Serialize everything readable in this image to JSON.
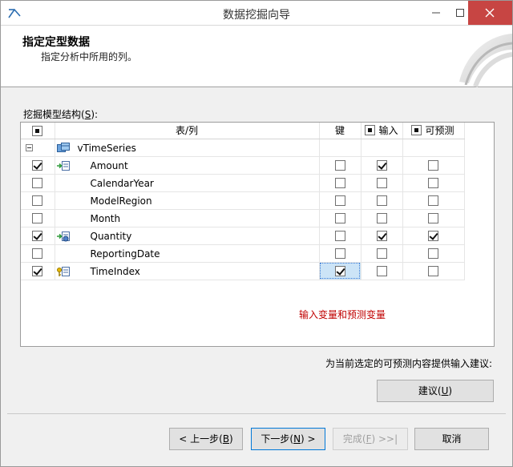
{
  "window": {
    "title": "数据挖掘向导"
  },
  "header": {
    "title": "指定定型数据",
    "subtitle": "指定分析中所用的列。"
  },
  "grid": {
    "label_prefix": "挖掘模型结构(",
    "label_key": "S",
    "label_suffix": "):",
    "columns": {
      "table_column": "表/列",
      "key": "键",
      "input": "输入",
      "predict": "可预测"
    },
    "header_checks": {
      "select": "indeterminate",
      "input": "indeterminate",
      "predict": "indeterminate"
    },
    "table_name": "vTimeSeries",
    "rows": [
      {
        "name": "Amount",
        "select": true,
        "icon": "input-column-icon",
        "key": false,
        "input": true,
        "predict": false
      },
      {
        "name": "CalendarYear",
        "select": false,
        "icon": "",
        "key": false,
        "input": false,
        "predict": false
      },
      {
        "name": "ModelRegion",
        "select": false,
        "icon": "",
        "key": false,
        "input": false,
        "predict": false
      },
      {
        "name": "Month",
        "select": false,
        "icon": "",
        "key": false,
        "input": false,
        "predict": false
      },
      {
        "name": "Quantity",
        "select": true,
        "icon": "predict-column-icon",
        "key": false,
        "input": true,
        "predict": true
      },
      {
        "name": "ReportingDate",
        "select": false,
        "icon": "",
        "key": false,
        "input": false,
        "predict": false
      },
      {
        "name": "TimeIndex",
        "select": true,
        "icon": "key-column-icon",
        "key": true,
        "input": false,
        "predict": false
      }
    ]
  },
  "annotation": "输入变量和预测变量",
  "suggest": {
    "hint": "为当前选定的可预测内容提供输入建议:",
    "button_prefix": "建议(",
    "button_key": "U",
    "button_suffix": ")"
  },
  "footer": {
    "back": {
      "prefix": "< 上一步(",
      "key": "B",
      "suffix": ")"
    },
    "next": {
      "prefix": "下一步(",
      "key": "N",
      "suffix": ") >"
    },
    "finish": {
      "prefix": "完成(",
      "key": "F",
      "suffix": ") >>|"
    },
    "cancel": "取消"
  },
  "colors": {
    "close_button": "#c74543",
    "annotation": "#c00000",
    "selection": "#cce4f7"
  }
}
